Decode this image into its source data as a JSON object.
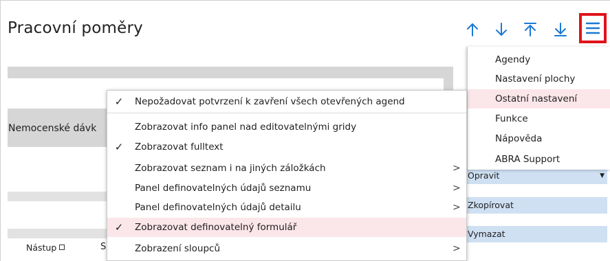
{
  "header": {
    "title": "Pracovní poměry"
  },
  "toolbar": {
    "nav_icons": [
      "arrow-up-icon",
      "arrow-down-icon",
      "arrow-to-top-icon",
      "arrow-to-bottom-icon"
    ],
    "menu_icon": "hamburger-menu-icon",
    "accent_color": "#1a78d4",
    "highlight_border_color": "#e1121b"
  },
  "background": {
    "section_label": "Nemocenské dávk",
    "columns": [
      "Nástup",
      "S"
    ]
  },
  "side_actions": [
    {
      "label": "Opravit"
    },
    {
      "label": "Zkopírovat"
    },
    {
      "label": "Vymazat"
    }
  ],
  "hamburger_menu": {
    "items": [
      {
        "label": "Agendy",
        "active": false
      },
      {
        "label": "Nastavení plochy",
        "active": false
      },
      {
        "label": "Ostatní nastavení",
        "active": true
      },
      {
        "label": "Funkce",
        "active": false
      },
      {
        "label": "Nápověda",
        "active": false
      },
      {
        "label": "ABRA Support",
        "active": false
      }
    ],
    "active_color": "#fbe6ea"
  },
  "settings_menu": {
    "items": [
      {
        "label": "Nepožadovat potvrzení k zavření všech otevřených agend",
        "checked": true,
        "submenu": false,
        "active": false
      },
      {
        "label": "Zobrazovat info panel nad editovatelnými gridy",
        "checked": false,
        "submenu": false,
        "active": false
      },
      {
        "label": "Zobrazovat fulltext",
        "checked": true,
        "submenu": false,
        "active": false
      },
      {
        "label": "Zobrazovat seznam i na jiných záložkách",
        "checked": false,
        "submenu": true,
        "active": false
      },
      {
        "label": "Panel definovatelných údajů seznamu",
        "checked": false,
        "submenu": true,
        "active": false
      },
      {
        "label": "Panel definovatelných údajů detailu",
        "checked": false,
        "submenu": true,
        "active": false
      },
      {
        "label": "Zobrazovat definovatelný formulář",
        "checked": true,
        "submenu": false,
        "active": true
      },
      {
        "label": "Zobrazení sloupců",
        "checked": false,
        "submenu": true,
        "active": false
      }
    ],
    "check_glyph": "✓",
    "submenu_glyph": ">"
  }
}
